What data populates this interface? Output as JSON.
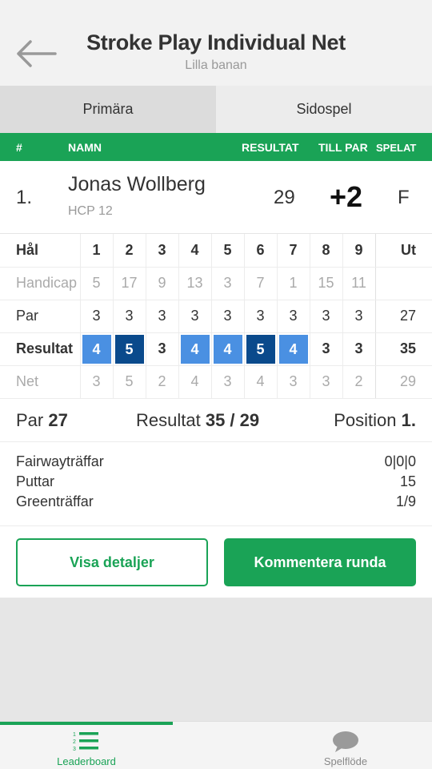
{
  "header": {
    "title": "Stroke Play Individual Net",
    "subtitle": "Lilla banan",
    "back_icon": "arrow-left-icon"
  },
  "tabs": [
    {
      "label": "Primära",
      "active": true
    },
    {
      "label": "Sidospel",
      "active": false
    }
  ],
  "columns": {
    "rank": "#",
    "name": "NAMN",
    "result": "RESULTAT",
    "to_par": "TILL PAR",
    "played": "SPELAT"
  },
  "player": {
    "rank": "1.",
    "name": "Jonas Wollberg",
    "hcp": "HCP 12",
    "result": "29",
    "to_par": "+2",
    "played": "F"
  },
  "scorecard": {
    "header_label": "Hål",
    "holes": [
      "1",
      "2",
      "3",
      "4",
      "5",
      "6",
      "7",
      "8",
      "9"
    ],
    "out_label": "Ut",
    "rows": {
      "handicap": {
        "label": "Handicap",
        "values": [
          "5",
          "17",
          "9",
          "13",
          "3",
          "7",
          "1",
          "15",
          "11"
        ],
        "total": ""
      },
      "par": {
        "label": "Par",
        "values": [
          "3",
          "3",
          "3",
          "3",
          "3",
          "3",
          "3",
          "3",
          "3"
        ],
        "total": "27"
      },
      "result": {
        "label": "Resultat",
        "values": [
          "4",
          "5",
          "3",
          "4",
          "4",
          "5",
          "4",
          "3",
          "3"
        ],
        "total": "35"
      },
      "net": {
        "label": "Net",
        "values": [
          "3",
          "5",
          "2",
          "4",
          "3",
          "4",
          "3",
          "3",
          "2"
        ],
        "total": "29"
      }
    }
  },
  "summary": {
    "par_label": "Par",
    "par_value": "27",
    "result_label": "Resultat",
    "result_value": "35 / 29",
    "position_label": "Position",
    "position_value": "1."
  },
  "stats": [
    {
      "label": "Fairwayträffar",
      "value": "0|0|0"
    },
    {
      "label": "Puttar",
      "value": "15"
    },
    {
      "label": "Greenträffar",
      "value": "1/9"
    }
  ],
  "buttons": {
    "details": "Visa detaljer",
    "comment": "Kommentera runda"
  },
  "bottom_nav": [
    {
      "label": "Leaderboard",
      "icon": "leaderboard-list-icon",
      "active": true
    },
    {
      "label": "Spelflöde",
      "icon": "chat-bubble-icon",
      "active": false
    }
  ],
  "colors": {
    "accent": "#1aa356",
    "bogey": "#4a90e2",
    "double_bogey": "#0a4a8c"
  }
}
